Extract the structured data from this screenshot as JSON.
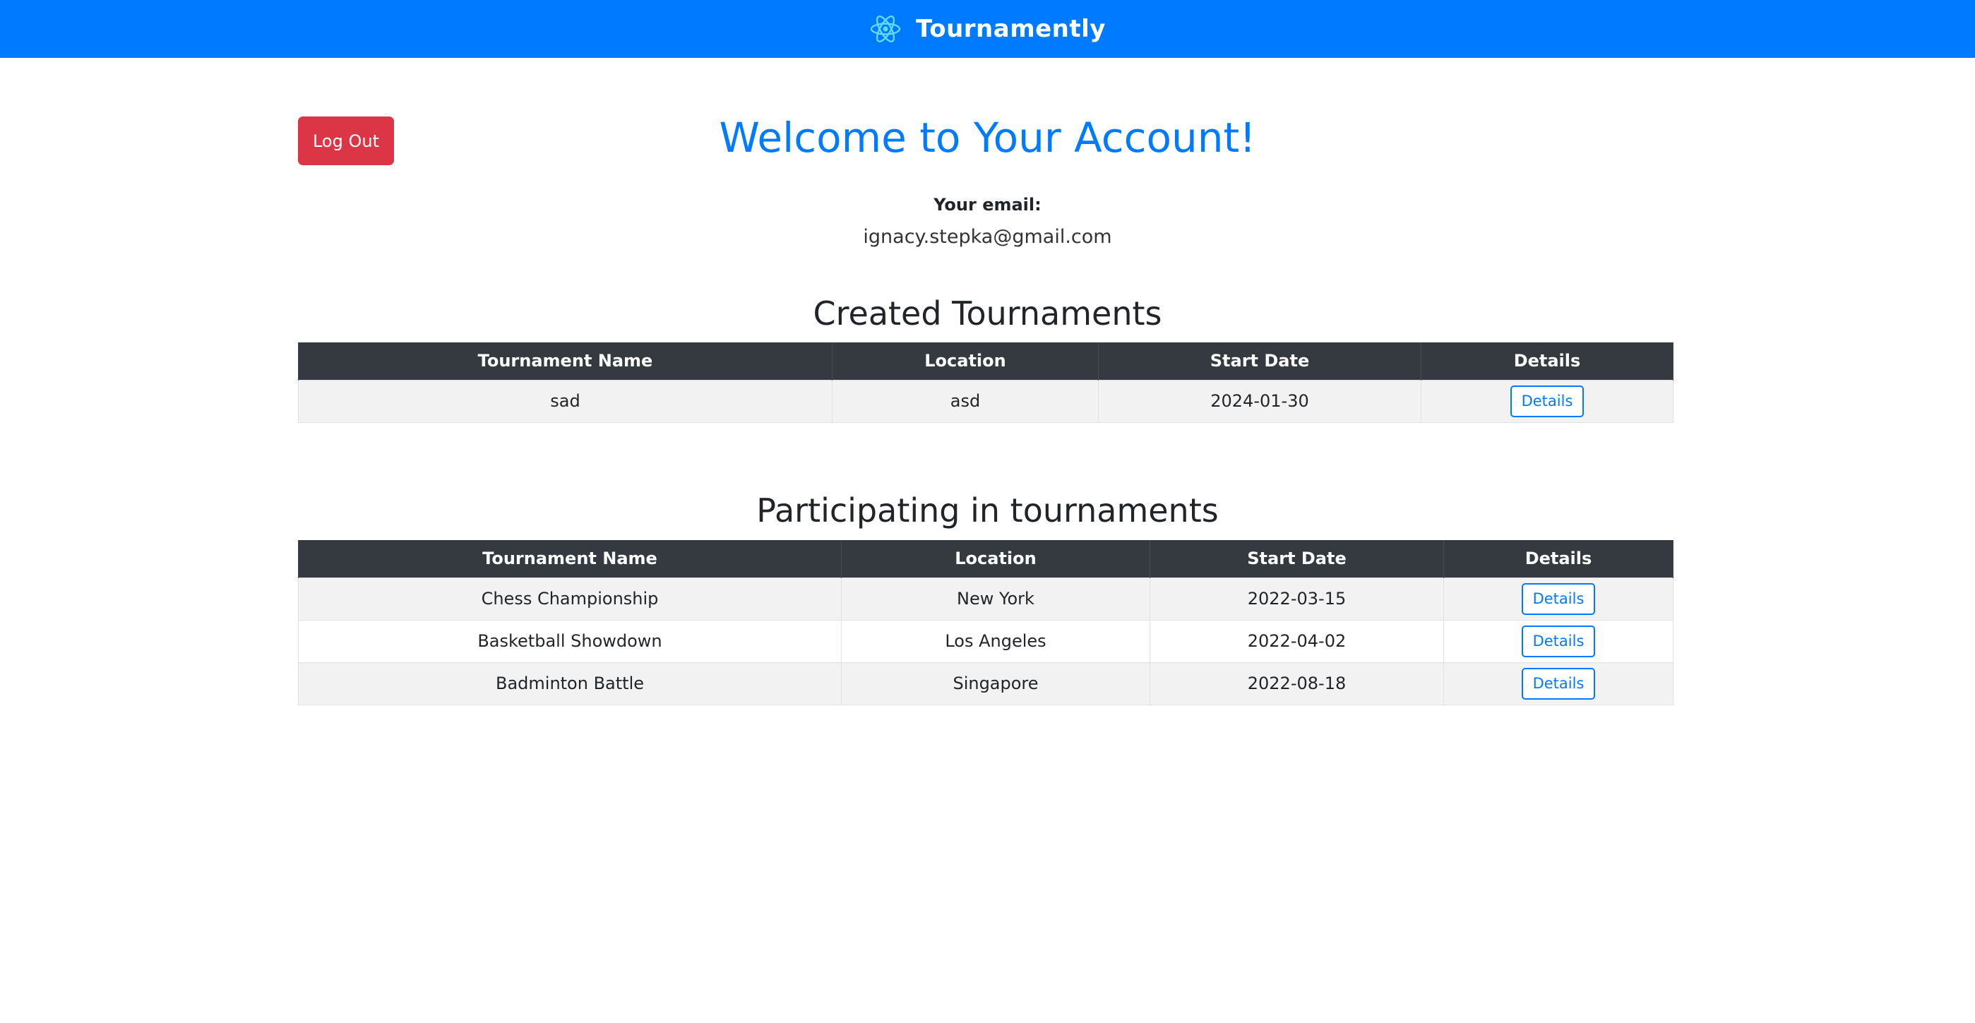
{
  "navbar": {
    "brand": "Tournamently",
    "logo_icon": "react-atom-icon",
    "background_color": "#007bff"
  },
  "account": {
    "logout_label": "Log Out",
    "welcome_heading": "Welcome to Your Account!",
    "email_label": "Your email:",
    "email_value": "ignacy.stepka@gmail.com"
  },
  "created": {
    "title": "Created Tournaments",
    "headers": [
      "Tournament Name",
      "Location",
      "Start Date",
      "Details"
    ],
    "rows": [
      {
        "name": "sad",
        "location": "asd",
        "start_date": "2024-01-30",
        "details_label": "Details"
      }
    ]
  },
  "participating": {
    "title": "Participating in tournaments",
    "headers": [
      "Tournament Name",
      "Location",
      "Start Date",
      "Details"
    ],
    "rows": [
      {
        "name": "Chess Championship",
        "location": "New York",
        "start_date": "2022-03-15",
        "details_label": "Details"
      },
      {
        "name": "Basketball Showdown",
        "location": "Los Angeles",
        "start_date": "2022-04-02",
        "details_label": "Details"
      },
      {
        "name": "Badminton Battle",
        "location": "Singapore",
        "start_date": "2022-08-18",
        "details_label": "Details"
      }
    ]
  },
  "colors": {
    "primary": "#007bff",
    "danger": "#dc3545",
    "table_header": "#343a40",
    "stripe": "#f2f2f2"
  }
}
